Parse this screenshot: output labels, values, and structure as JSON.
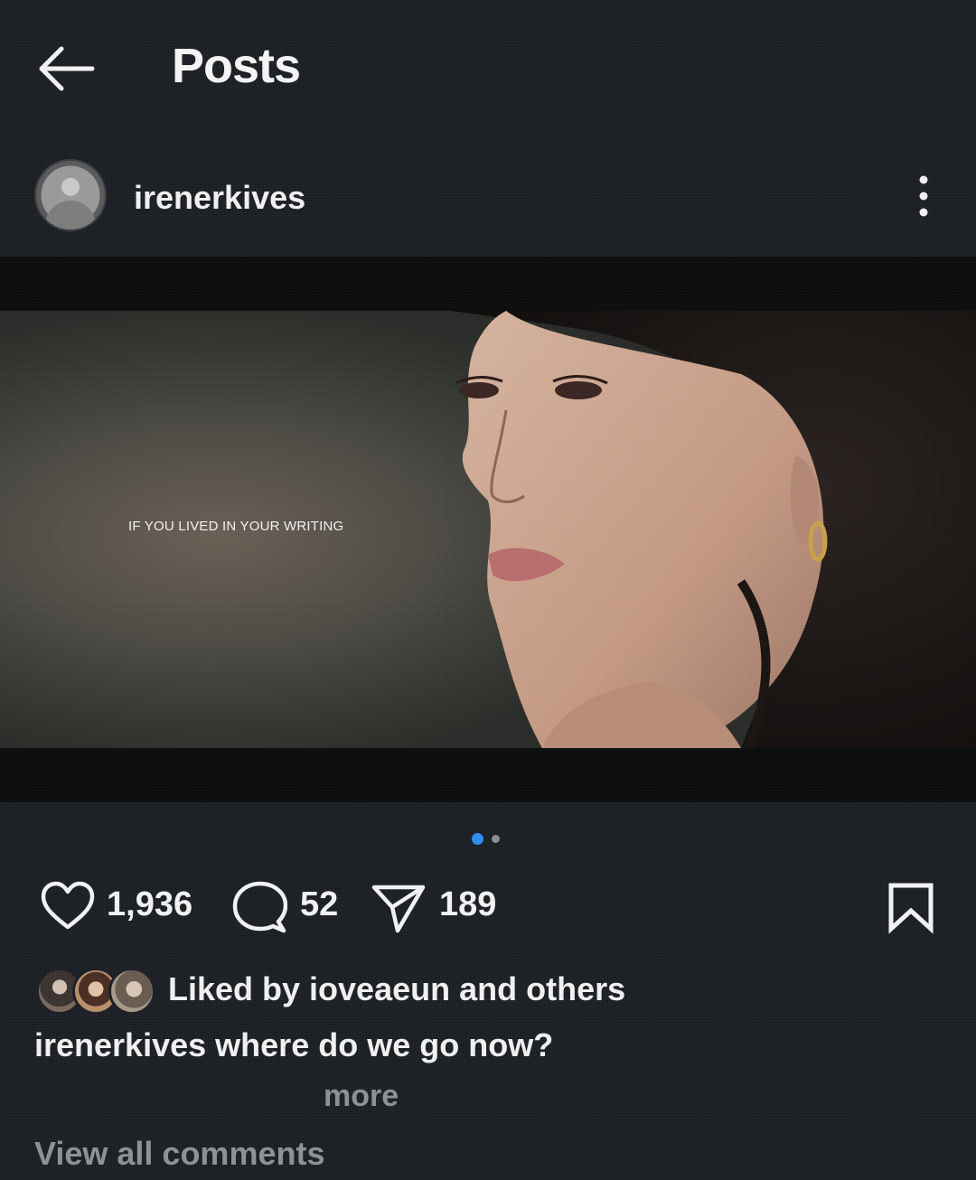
{
  "header": {
    "title": "Posts"
  },
  "post": {
    "username": "irenerkives",
    "image_text": "IF YOU LIVED IN YOUR WRITING",
    "carousel": {
      "total": 2,
      "active": 1
    },
    "likes_count": "1,936",
    "comments_count": "52",
    "shares_count": "189",
    "liked_by_text": "Liked by ioveaeun and others",
    "caption_user": "irenerkives",
    "caption_text": "where do we go now?",
    "more_label": "more",
    "view_comments_label": "View all comments"
  },
  "colors": {
    "background": "#1d2126",
    "text": "#f0f0f0",
    "muted": "#8e9197",
    "accent": "#2d8ef0"
  },
  "icons": {
    "back": "arrow-left-icon",
    "more": "more-vertical-icon",
    "like": "heart-icon",
    "comment": "comment-icon",
    "share": "send-icon",
    "save": "bookmark-icon"
  }
}
